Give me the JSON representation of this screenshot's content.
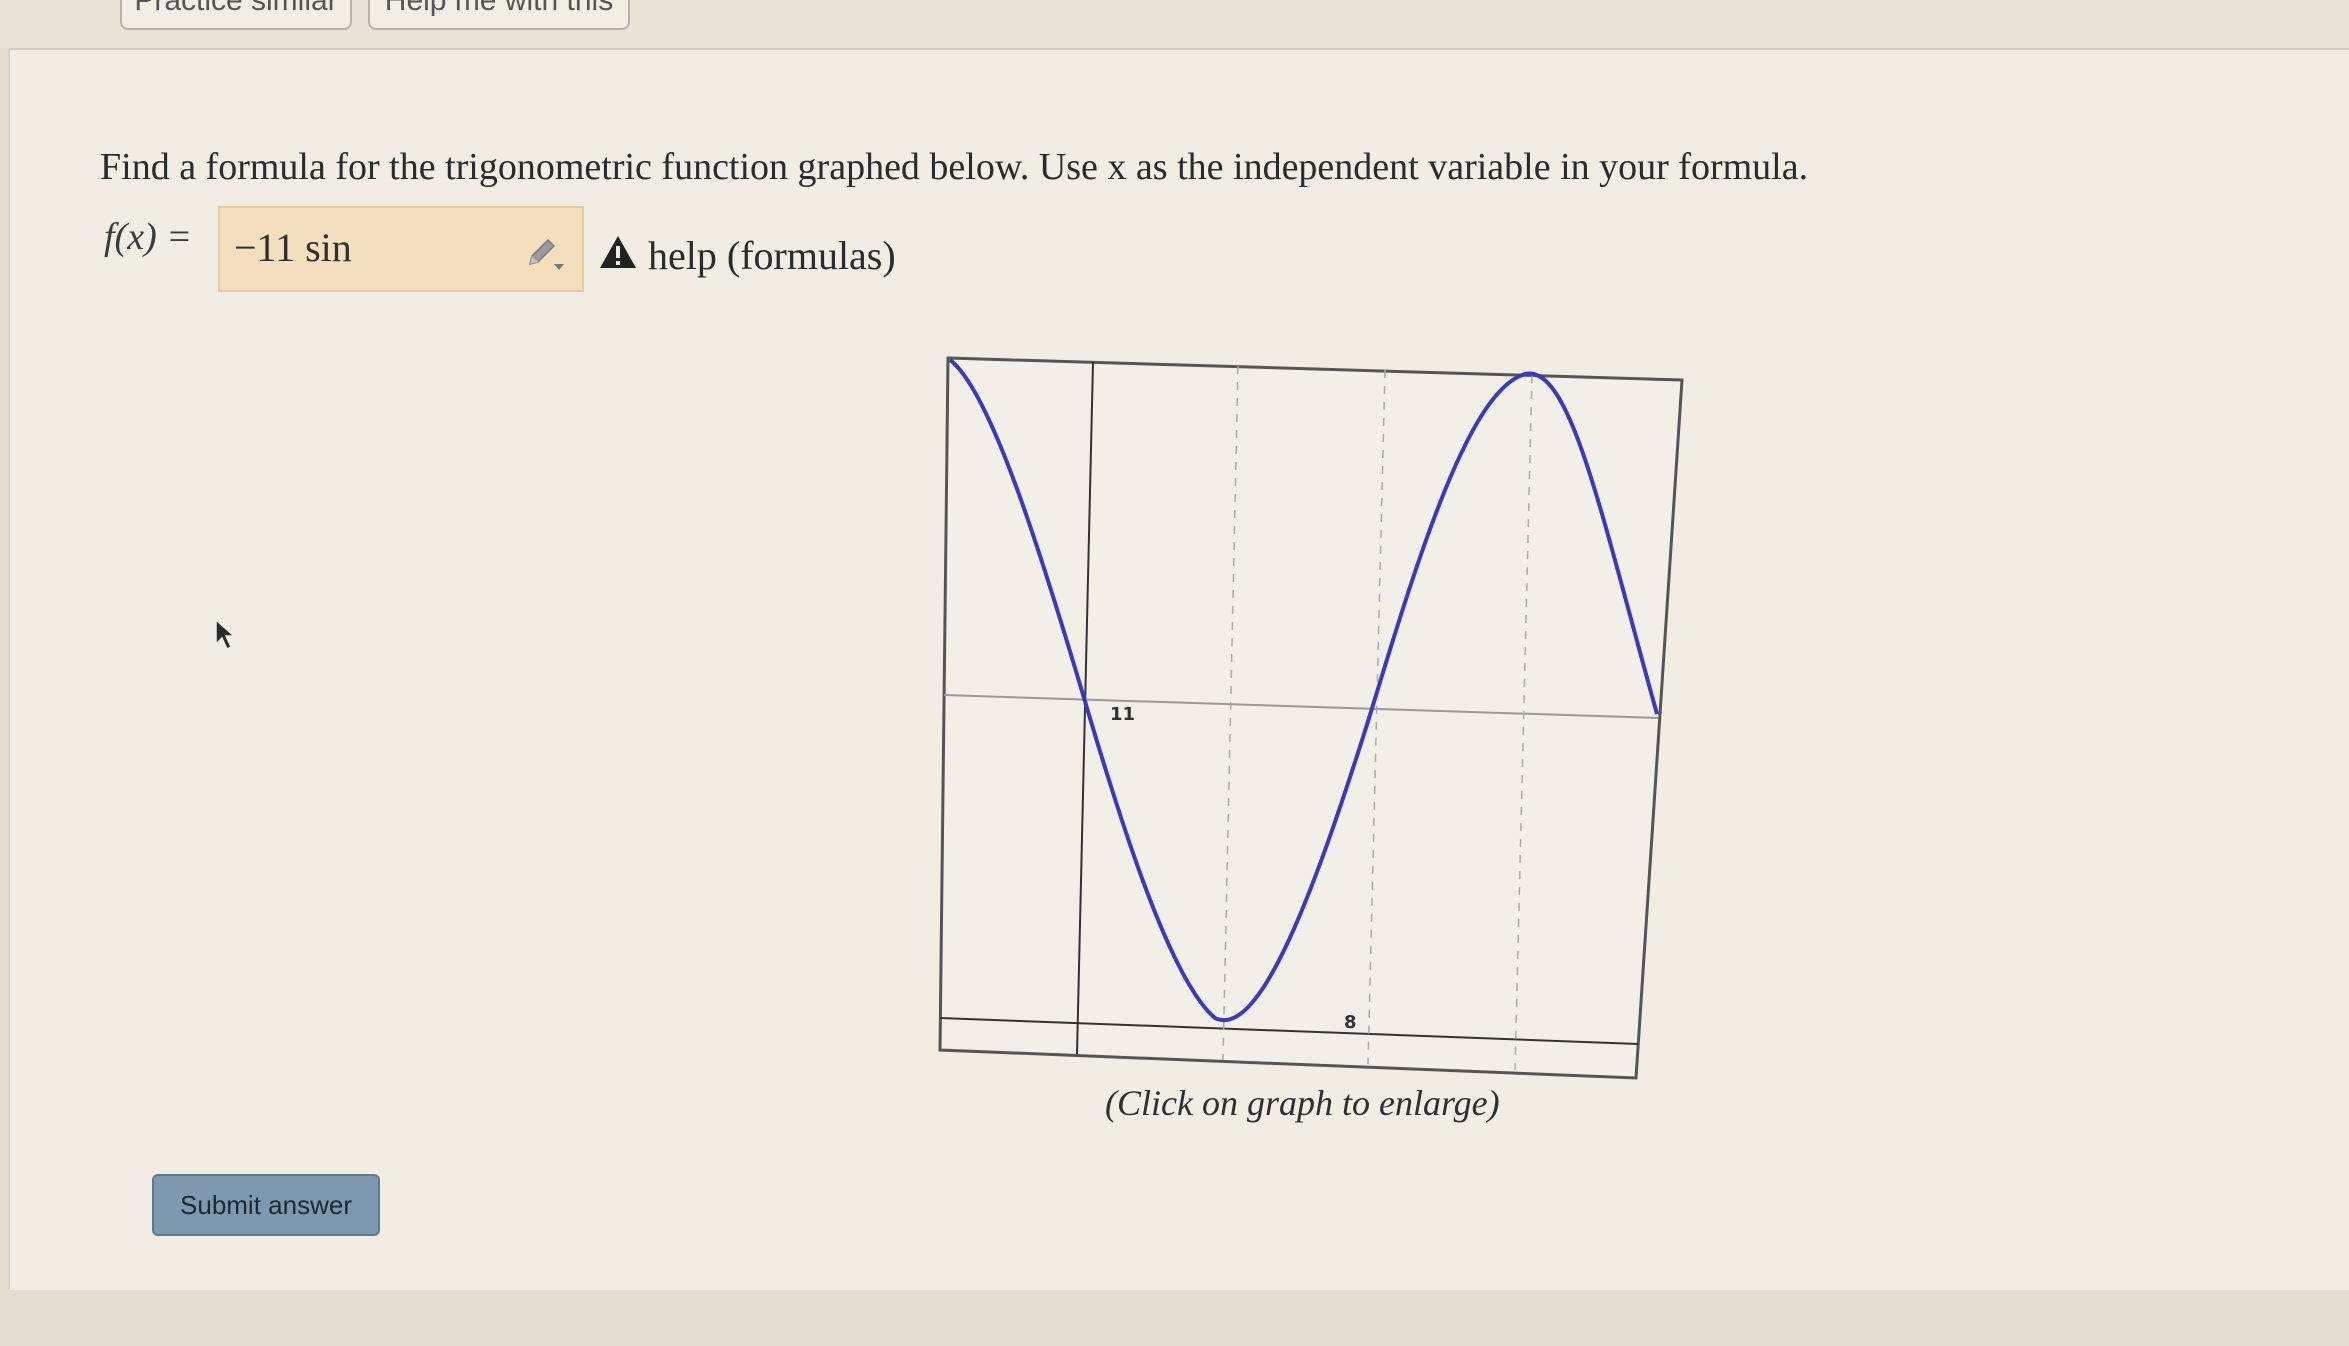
{
  "toolbar": {
    "practice_label": "Practice similar",
    "help_label": "Help me with this"
  },
  "problem": {
    "text": "Find a formula for the trigonometric function graphed below. Use x as the independent variable in your formula.",
    "fx_label": "f(x) =",
    "answer_value": "−11 sin",
    "help_link": "help (formulas)"
  },
  "graph": {
    "caption": "(Click on graph to enlarge)",
    "axis_label_y": "11",
    "axis_label_x": "8",
    "curve_color": "#3b3bb8"
  },
  "actions": {
    "submit_label": "Submit answer"
  },
  "icons": {
    "pencil": "pencil-icon",
    "warning": "warning-icon",
    "cursor": "cursor-icon"
  }
}
